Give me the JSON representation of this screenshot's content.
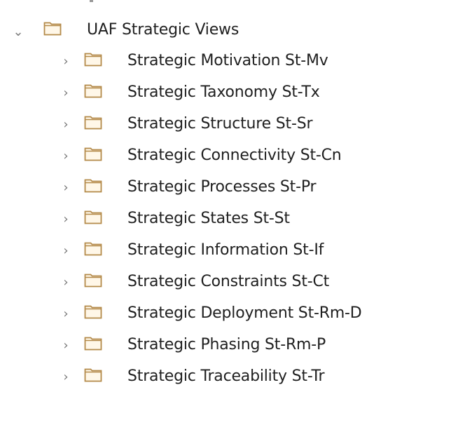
{
  "tree": {
    "root": {
      "label": "UAF Strategic Views",
      "expanded_icon": "chevron-down-icon",
      "folder_icon": "folder-icon"
    },
    "children": [
      {
        "label": "Strategic Motivation St-Mv"
      },
      {
        "label": "Strategic Taxonomy St-Tx"
      },
      {
        "label": "Strategic Structure St-Sr"
      },
      {
        "label": "Strategic Connectivity St-Cn"
      },
      {
        "label": "Strategic Processes St-Pr"
      },
      {
        "label": "Strategic States St-St"
      },
      {
        "label": "Strategic Information St-If"
      },
      {
        "label": "Strategic Constraints St-Ct"
      },
      {
        "label": "Strategic Deployment St-Rm-D"
      },
      {
        "label": "Strategic Phasing St-Rm-P"
      },
      {
        "label": "Strategic Traceability St-Tr"
      }
    ],
    "collapsed_icon": "chevron-right-icon",
    "folder_color": "#e8d2a8",
    "folder_stroke": "#b48a4a"
  }
}
